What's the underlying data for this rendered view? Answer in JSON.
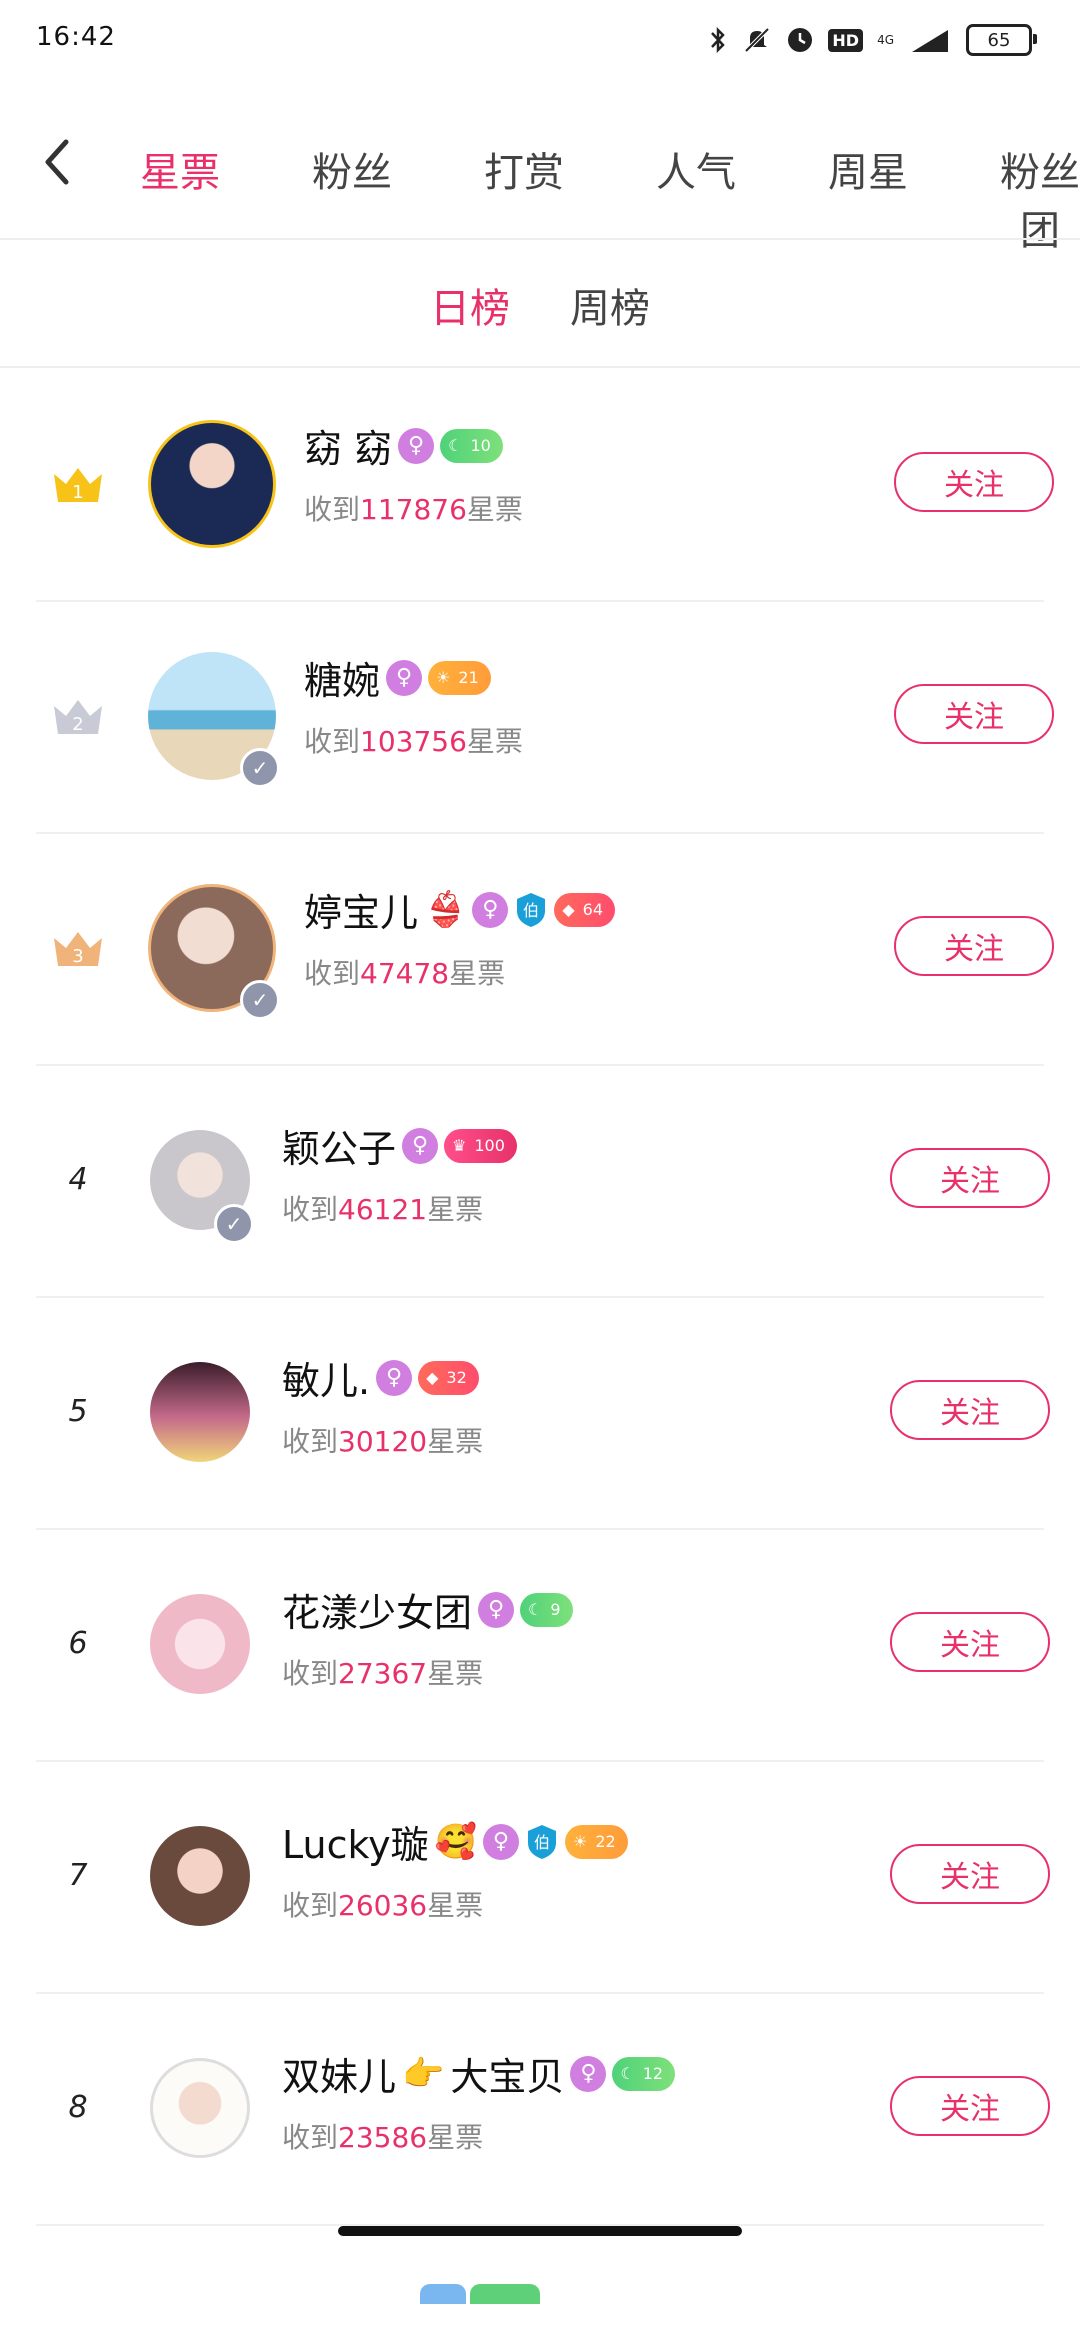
{
  "status_bar": {
    "time": "16:42",
    "network": "4G",
    "hd": "HD",
    "battery": "65"
  },
  "top_tabs": [
    "星票",
    "粉丝",
    "打赏",
    "人气",
    "周星",
    "粉丝团"
  ],
  "sub_tabs": [
    "日榜",
    "周榜"
  ],
  "received_prefix": "收到",
  "received_suffix": "星票",
  "follow_label": "关注",
  "rows": [
    {
      "rank": "1",
      "name": "窈  窈",
      "count": "117876",
      "badges": [
        "female",
        "green:10"
      ]
    },
    {
      "rank": "2",
      "name": "糖婉",
      "count": "103756",
      "badges": [
        "female",
        "orange:21"
      ]
    },
    {
      "rank": "3",
      "name": "婷宝儿",
      "emoji": "👙",
      "count": "47478",
      "badges": [
        "female",
        "shield:伯",
        "red:64"
      ]
    },
    {
      "rank": "4",
      "name": "颖公子",
      "count": "46121",
      "badges": [
        "female",
        "pink:100"
      ]
    },
    {
      "rank": "5",
      "name": "敏儿.",
      "count": "30120",
      "badges": [
        "female",
        "red:32"
      ]
    },
    {
      "rank": "6",
      "name": "花漾少女团",
      "count": "27367",
      "badges": [
        "female",
        "green:9"
      ]
    },
    {
      "rank": "7",
      "name": "Lucky璇",
      "emoji": "🥰",
      "count": "26036",
      "badges": [
        "female",
        "shield:伯",
        "orange:22"
      ]
    },
    {
      "rank": "8",
      "name": "双妹儿",
      "emoji": "👉",
      "name2": "大宝贝",
      "count": "23586",
      "badges": [
        "female",
        "green:12"
      ]
    }
  ],
  "colors": {
    "accent": "#e8316a",
    "gold": "#f7c318",
    "silver": "#c8cad6",
    "bronze": "#f0b47a"
  }
}
